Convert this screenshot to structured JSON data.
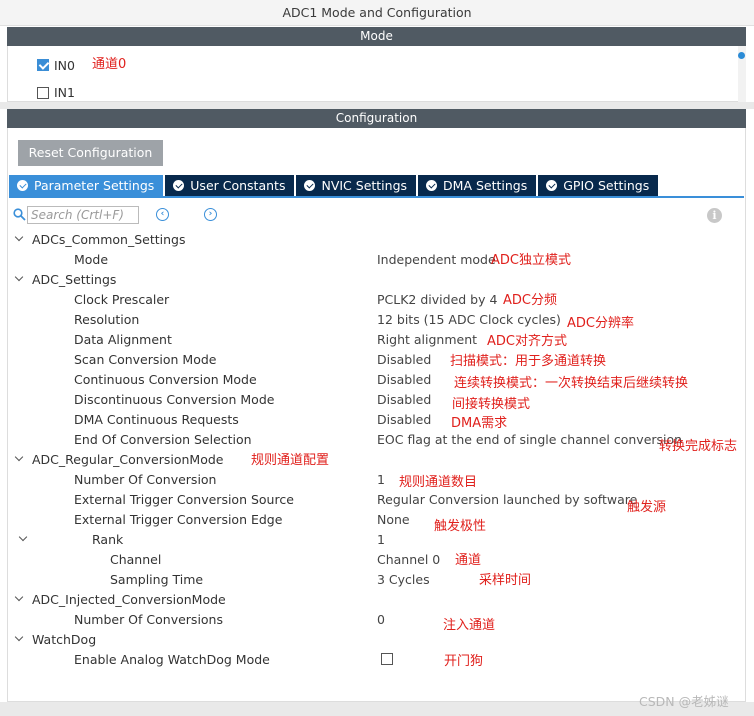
{
  "window": {
    "title": "ADC1 Mode and Configuration"
  },
  "mode": {
    "header": "Mode",
    "channels": [
      {
        "label": "IN0",
        "checked": true,
        "note": "通道0"
      },
      {
        "label": "IN1",
        "checked": false
      }
    ]
  },
  "config": {
    "header": "Configuration",
    "reset_label": "Reset Configuration",
    "tabs": [
      {
        "label": "Parameter Settings",
        "active": true
      },
      {
        "label": "User Constants"
      },
      {
        "label": "NVIC Settings"
      },
      {
        "label": "DMA Settings"
      },
      {
        "label": "GPIO Settings"
      }
    ],
    "search_placeholder": "Search (Crtl+F)",
    "nav_prev": "‹",
    "nav_next": "›",
    "info": "i"
  },
  "params": [
    {
      "indent": 0,
      "label": "ADCs_Common_Settings",
      "group": true
    },
    {
      "indent": 1,
      "label": "Mode",
      "value": "Independent mode",
      "note": "ADC独立模式"
    },
    {
      "indent": 0,
      "label": "ADC_Settings",
      "group": true
    },
    {
      "indent": 1,
      "label": "Clock Prescaler",
      "value": "PCLK2 divided by 4",
      "note": "ADC分频"
    },
    {
      "indent": 1,
      "label": "Resolution",
      "value": "12 bits (15 ADC Clock cycles)",
      "note": "ADC分辨率"
    },
    {
      "indent": 1,
      "label": "Data Alignment",
      "value": "Right alignment",
      "note": "ADC对齐方式"
    },
    {
      "indent": 1,
      "label": "Scan Conversion Mode",
      "value": "Disabled",
      "note": "扫描模式：用于多通道转换"
    },
    {
      "indent": 1,
      "label": "Continuous Conversion Mode",
      "value": "Disabled",
      "note": "连续转换模式：一次转换结束后继续转换"
    },
    {
      "indent": 1,
      "label": "Discontinuous Conversion Mode",
      "value": "Disabled",
      "note": "间接转换模式"
    },
    {
      "indent": 1,
      "label": "DMA Continuous Requests",
      "value": "Disabled",
      "note": "DMA需求"
    },
    {
      "indent": 1,
      "label": "End Of Conversion Selection",
      "value": "EOC flag at the end of single channel conversion",
      "note": "转换完成标志"
    },
    {
      "indent": 0,
      "label": "ADC_Regular_ConversionMode",
      "group": true,
      "note": "规则通道配置"
    },
    {
      "indent": 1,
      "label": "Number Of Conversion",
      "value": "1",
      "note": "规则通道数目"
    },
    {
      "indent": 1,
      "label": "External Trigger Conversion Source",
      "value": "Regular Conversion launched by software",
      "note": "触发源"
    },
    {
      "indent": 1,
      "label": "External Trigger Conversion Edge",
      "value": "None",
      "note": "触发极性"
    },
    {
      "indent": 2,
      "label": "Rank",
      "value": "1",
      "group": true
    },
    {
      "indent": 3,
      "label": "Channel",
      "value": "Channel 0",
      "note": "通道"
    },
    {
      "indent": 3,
      "label": "Sampling Time",
      "value": "3 Cycles",
      "note": "采样时间"
    },
    {
      "indent": 0,
      "label": "ADC_Injected_ConversionMode",
      "group": true
    },
    {
      "indent": 1,
      "label": "Number Of Conversions",
      "value": "0",
      "note": "注入通道"
    },
    {
      "indent": 0,
      "label": "WatchDog",
      "group": true
    },
    {
      "indent": 1,
      "label": "Enable Analog WatchDog Mode",
      "checkbox": true,
      "checked": false,
      "note": "开门狗"
    }
  ],
  "watermark": "CSDN @老姊谜"
}
